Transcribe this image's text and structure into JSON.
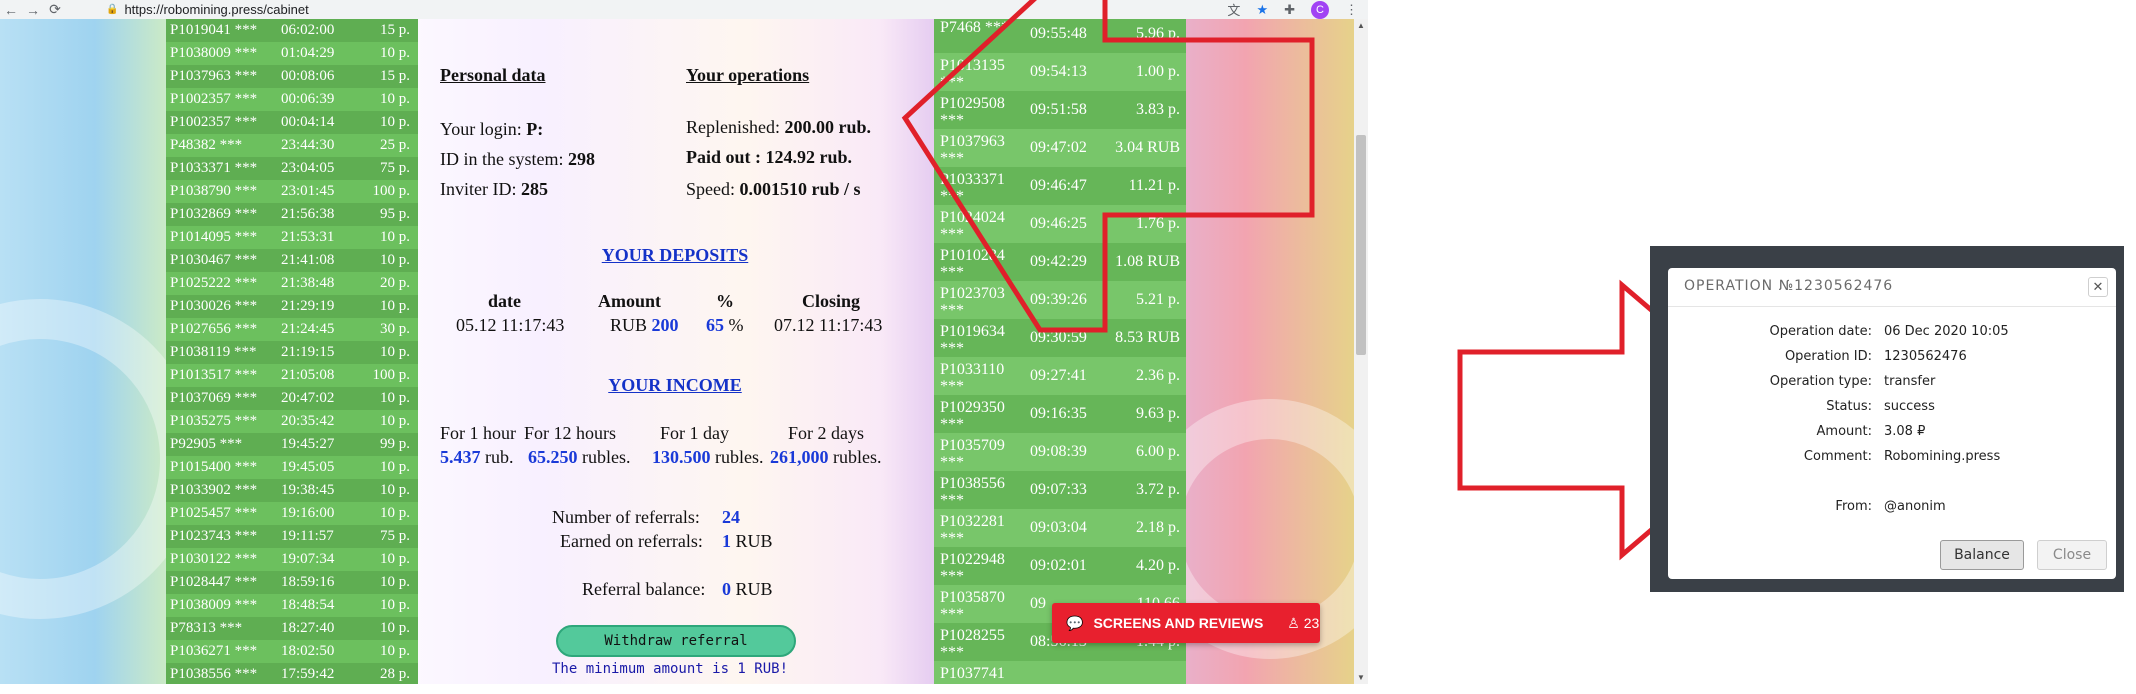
{
  "browser": {
    "url": "https://robomining.press/cabinet",
    "avatar_letter": "C"
  },
  "left_ticker": [
    {
      "login": "P1019041 ***",
      "time": "06:02:00",
      "amount": "15 p."
    },
    {
      "login": "P1038009 ***",
      "time": "01:04:29",
      "amount": "10 p."
    },
    {
      "login": "P1037963 ***",
      "time": "00:08:06",
      "amount": "15 p."
    },
    {
      "login": "P1002357 ***",
      "time": "00:06:39",
      "amount": "10 p."
    },
    {
      "login": "P1002357 ***",
      "time": "00:04:14",
      "amount": "10 p."
    },
    {
      "login": "P48382 ***",
      "time": "23:44:30",
      "amount": "25 p."
    },
    {
      "login": "P1033371 ***",
      "time": "23:04:05",
      "amount": "75 p."
    },
    {
      "login": "P1038790 ***",
      "time": "23:01:45",
      "amount": "100 p."
    },
    {
      "login": "P1032869 ***",
      "time": "21:56:38",
      "amount": "95 p."
    },
    {
      "login": "P1014095 ***",
      "time": "21:53:31",
      "amount": "10 p."
    },
    {
      "login": "P1030467 ***",
      "time": "21:41:08",
      "amount": "10 p."
    },
    {
      "login": "P1025222 ***",
      "time": "21:38:48",
      "amount": "20 p."
    },
    {
      "login": "P1030026 ***",
      "time": "21:29:19",
      "amount": "10 p."
    },
    {
      "login": "P1027656 ***",
      "time": "21:24:45",
      "amount": "30 p."
    },
    {
      "login": "P1038119 ***",
      "time": "21:19:15",
      "amount": "10 p."
    },
    {
      "login": "P1013517 ***",
      "time": "21:05:08",
      "amount": "100 p."
    },
    {
      "login": "P1037069 ***",
      "time": "20:47:02",
      "amount": "10 p."
    },
    {
      "login": "P1035275 ***",
      "time": "20:35:42",
      "amount": "10 p."
    },
    {
      "login": "P92905 ***",
      "time": "19:45:27",
      "amount": "99 p."
    },
    {
      "login": "P1015400 ***",
      "time": "19:45:05",
      "amount": "10 p."
    },
    {
      "login": "P1033902 ***",
      "time": "19:38:45",
      "amount": "10 p."
    },
    {
      "login": "P1025457 ***",
      "time": "19:16:00",
      "amount": "10 p."
    },
    {
      "login": "P1023743 ***",
      "time": "19:11:57",
      "amount": "75 p."
    },
    {
      "login": "P1030122 ***",
      "time": "19:07:34",
      "amount": "10 p."
    },
    {
      "login": "P1028447 ***",
      "time": "18:59:16",
      "amount": "10 p."
    },
    {
      "login": "P1038009 ***",
      "time": "18:48:54",
      "amount": "10 p."
    },
    {
      "login": "P78313 ***",
      "time": "18:27:40",
      "amount": "10 p."
    },
    {
      "login": "P1036271 ***",
      "time": "18:02:50",
      "amount": "10 p."
    },
    {
      "login": "P1038556 ***",
      "time": "17:59:42",
      "amount": "28 p."
    }
  ],
  "personal": {
    "title": "Personal data",
    "login_label": "Your login:",
    "login_value": "P:",
    "id_label": "ID in the system:",
    "id_value": "298",
    "inviter_label": "Inviter ID:",
    "inviter_value": "285"
  },
  "operations": {
    "title": "Your operations",
    "replenished_label": "Replenished:",
    "replenished_value": "200.00 rub.",
    "paid_label": "Paid out",
    "paid_value": ": 124.92 rub.",
    "speed_label": "Speed:",
    "speed_value": "0.001510 rub / s"
  },
  "deposits": {
    "title": "YOUR DEPOSITS",
    "headers": [
      "date",
      "Amount",
      "%",
      "Closing"
    ],
    "date": "05.12 11:17:43",
    "currency": "RUB",
    "amount": "200",
    "percent": "65",
    "percent_sign": "%",
    "closing": "07.12 11:17:43"
  },
  "income": {
    "title": "YOUR INCOME",
    "periods": [
      {
        "label": "For 1 hour",
        "value": "5.437",
        "unit": "rub."
      },
      {
        "label": "For 12 hours",
        "value": "65.250",
        "unit": "rubles."
      },
      {
        "label": "For 1 day",
        "value": "130.500",
        "unit": "rubles."
      },
      {
        "label": "For 2 days",
        "value": "261,000",
        "unit": "rubles."
      }
    ]
  },
  "referrals": {
    "count_label": "Number of referrals:",
    "count_value": "24",
    "earned_label": "Earned on referrals:",
    "earned_value": "1",
    "earned_unit": "RUB",
    "balance_label": "Referral balance:",
    "balance_value": "0",
    "balance_unit": "RUB",
    "withdraw_label": "Withdraw referral",
    "min_note": "The minimum amount is 1 RUB!"
  },
  "right_ticker": [
    {
      "login": "P7468 ***",
      "time": "09:55:48",
      "amount": "5.96 p."
    },
    {
      "login": "P1013135 ***",
      "time": "09:54:13",
      "amount": "1.00 p."
    },
    {
      "login": "P1029508 ***",
      "time": "09:51:58",
      "amount": "3.83 p."
    },
    {
      "login": "P1037963 ***",
      "time": "09:47:02",
      "amount": "3.04 RUB"
    },
    {
      "login": "P1033371 ***",
      "time": "09:46:47",
      "amount": "11.21 p."
    },
    {
      "login": "P1024024 ***",
      "time": "09:46:25",
      "amount": "1.76 p."
    },
    {
      "login": "P1010284 ***",
      "time": "09:42:29",
      "amount": "1.08 RUB"
    },
    {
      "login": "P1023703 ***",
      "time": "09:39:26",
      "amount": "5.21 p."
    },
    {
      "login": "P1019634 ***",
      "time": "09:30:59",
      "amount": "8.53 RUB"
    },
    {
      "login": "P1033110 ***",
      "time": "09:27:41",
      "amount": "2.36 p."
    },
    {
      "login": "P1029350 ***",
      "time": "09:16:35",
      "amount": "9.63 p."
    },
    {
      "login": "P1035709 ***",
      "time": "09:08:39",
      "amount": "6.00 p."
    },
    {
      "login": "P1038556 ***",
      "time": "09:07:33",
      "amount": "3.72 p."
    },
    {
      "login": "P1032281 ***",
      "time": "09:03:04",
      "amount": "2.18 p."
    },
    {
      "login": "P1022948 ***",
      "time": "09:02:01",
      "amount": "4.20 p."
    },
    {
      "login": "P1035870 ***",
      "time": "09",
      "amount": "110.66"
    },
    {
      "login": "P1028255 ***",
      "time": "08:56:13",
      "amount": "1.44 p."
    },
    {
      "login": "P1037741",
      "time": "",
      "amount": ""
    }
  ],
  "screens": {
    "label": "SCREENS AND REVIEWS",
    "count": "23"
  },
  "dialog": {
    "title": "OPERATION №1230562476",
    "fields": [
      {
        "key": "Operation date:",
        "value": "06 Dec 2020 10:05"
      },
      {
        "key": "Operation ID:",
        "value": "1230562476"
      },
      {
        "key": "Operation type:",
        "value": "transfer"
      },
      {
        "key": "Status:",
        "value": "success"
      },
      {
        "key": "Amount:",
        "value": "3.08 ₽"
      },
      {
        "key": "Comment:",
        "value": "Robomining.press"
      }
    ],
    "from_key": "From:",
    "from_value": "@anonim",
    "balance_label": "Balance",
    "close_label": "Close"
  },
  "colors": {
    "accent_red": "#e0202a",
    "ticker_green": "#66b658",
    "link_blue": "#1432c8",
    "withdraw_green": "#53c99b"
  }
}
